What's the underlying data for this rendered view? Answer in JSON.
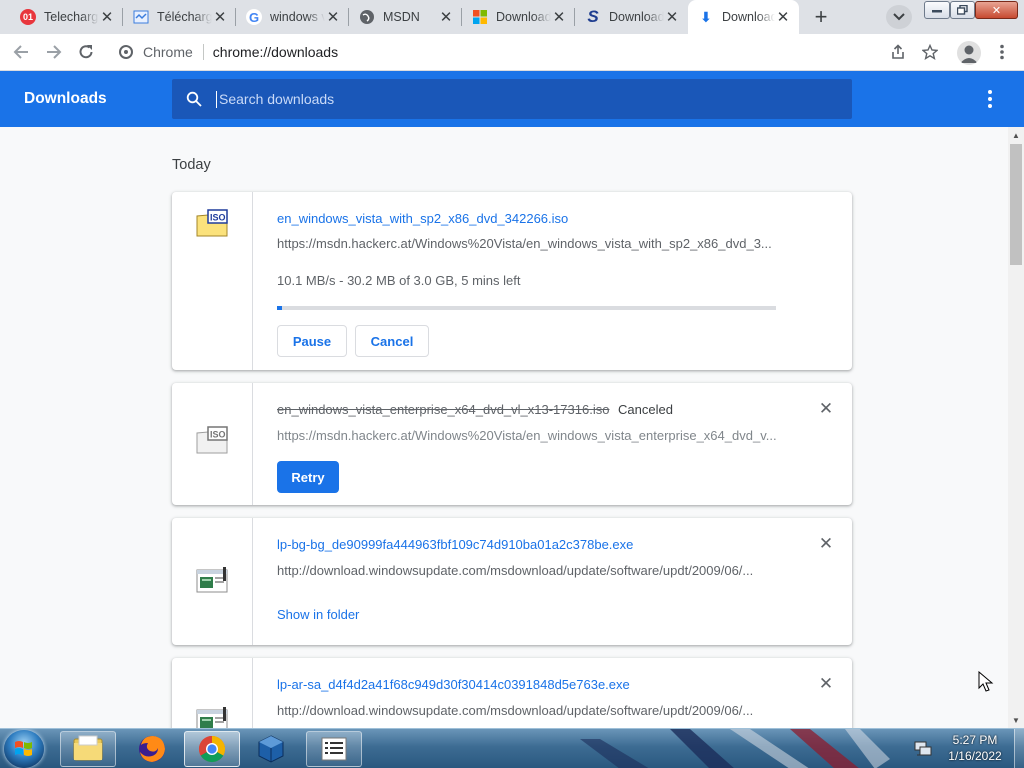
{
  "tabs": [
    {
      "title": "Telechargement",
      "favicon_text": "01",
      "favicon_color": "#e8363d"
    },
    {
      "title": "Téléchargement",
      "favicon_text": "",
      "favicon_color": "#3b7ddd"
    },
    {
      "title": "windows vista iso",
      "favicon_text": "G",
      "favicon_color": "#4285f4"
    },
    {
      "title": "MSDN",
      "favicon_text": "",
      "favicon_color": "#5f6368"
    },
    {
      "title": "Download",
      "favicon_text": "",
      "favicon_color": "#f25022"
    },
    {
      "title": "Download",
      "favicon_text": "S",
      "favicon_color": "#1e3d8f"
    },
    {
      "title": "Downloads",
      "favicon_text": "⬇",
      "favicon_color": "#1a73e8"
    }
  ],
  "omnibox": {
    "site_label": "Chrome",
    "url": "chrome://downloads"
  },
  "downloads_page": {
    "title": "Downloads",
    "search_placeholder": "Search downloads",
    "day_label": "Today"
  },
  "downloads": [
    {
      "file_name": "en_windows_vista_with_sp2_x86_dvd_342266.iso",
      "url": "https://msdn.hackerc.at/Windows%20Vista/en_windows_vista_with_sp2_x86_dvd_3...",
      "progress_text": "10.1 MB/s - 30.2 MB of 3.0 GB, 5 mins left",
      "progress_fraction": 0.01,
      "pause_label": "Pause",
      "cancel_label": "Cancel",
      "file_icon": "iso-file-icon"
    },
    {
      "file_name": "en_windows_vista_enterprise_x64_dvd_vl_x13-17316.iso",
      "status": "Canceled",
      "url": "https://msdn.hackerc.at/Windows%20Vista/en_windows_vista_enterprise_x64_dvd_v...",
      "retry_label": "Retry",
      "file_icon": "iso-file-icon"
    },
    {
      "file_name": "lp-bg-bg_de90999fa444963fbf109c74d910ba01a2c378be.exe",
      "url": "http://download.windowsupdate.com/msdownload/update/software/updt/2009/06/...",
      "show_in_folder_label": "Show in folder",
      "file_icon": "exe-file-icon"
    },
    {
      "file_name": "lp-ar-sa_d4f4d2a41f68c949d30f30414c0391848d5e763e.exe",
      "url": "http://download.windowsupdate.com/msdownload/update/software/updt/2009/06/...",
      "file_icon": "exe-file-icon"
    }
  ],
  "taskbar": {
    "apps": [
      "file-explorer-icon",
      "firefox-icon",
      "chrome-icon",
      "virtualbox-icon",
      "task-list-icon"
    ],
    "time": "5:27 PM",
    "date": "1/16/2022"
  },
  "colors": {
    "accent": "#1a73e8",
    "header_bg": "#1a73e8",
    "search_bg": "#1a57b8"
  }
}
